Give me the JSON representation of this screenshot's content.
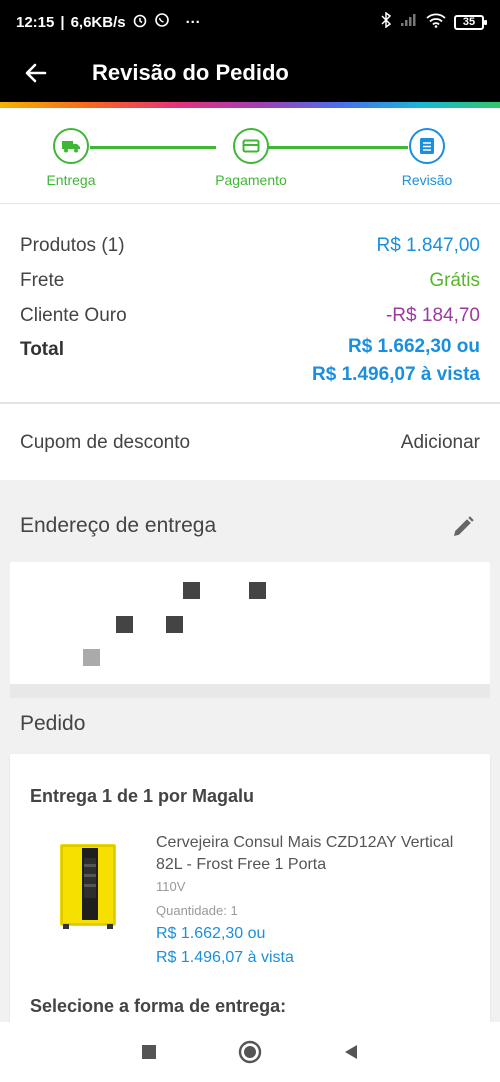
{
  "status_bar": {
    "time": "12:15",
    "speed": "6,6KB/s",
    "more": "···",
    "battery": "35"
  },
  "app_bar": {
    "title": "Revisão do Pedido"
  },
  "stepper": {
    "steps": [
      {
        "label": "Entrega",
        "state": "done",
        "icon": "truck-icon"
      },
      {
        "label": "Pagamento",
        "state": "done",
        "icon": "card-icon"
      },
      {
        "label": "Revisão",
        "state": "active",
        "icon": "list-icon"
      }
    ],
    "colors": {
      "done": "#40b637",
      "active": "#1a8fdd"
    }
  },
  "summary": {
    "products_label": "Produtos (1)",
    "products_value": "R$ 1.847,00",
    "shipping_label": "Frete",
    "shipping_value": "Grátis",
    "gold_label": "Cliente Ouro",
    "gold_value": "-R$ 184,70",
    "total_label": "Total",
    "total_installments": "R$ 1.662,30 ou",
    "total_cash": "R$ 1.496,07 à vista"
  },
  "coupon": {
    "label": "Cupom de desconto",
    "action": "Adicionar"
  },
  "address": {
    "title": "Endereço de entrega"
  },
  "order": {
    "title": "Pedido",
    "shipment_title": "Entrega 1 de 1 por Magalu",
    "product": {
      "name": "Cervejeira Consul Mais CZD12AY Vertical 82L - Frost Free 1 Porta",
      "voltage": "110V",
      "quantity": "Quantidade:  1",
      "price_installments": "R$ 1.662,30 ou",
      "price_cash": "R$ 1.496,07 à vista"
    },
    "select_shipping": "Selecione a forma de entrega:"
  }
}
